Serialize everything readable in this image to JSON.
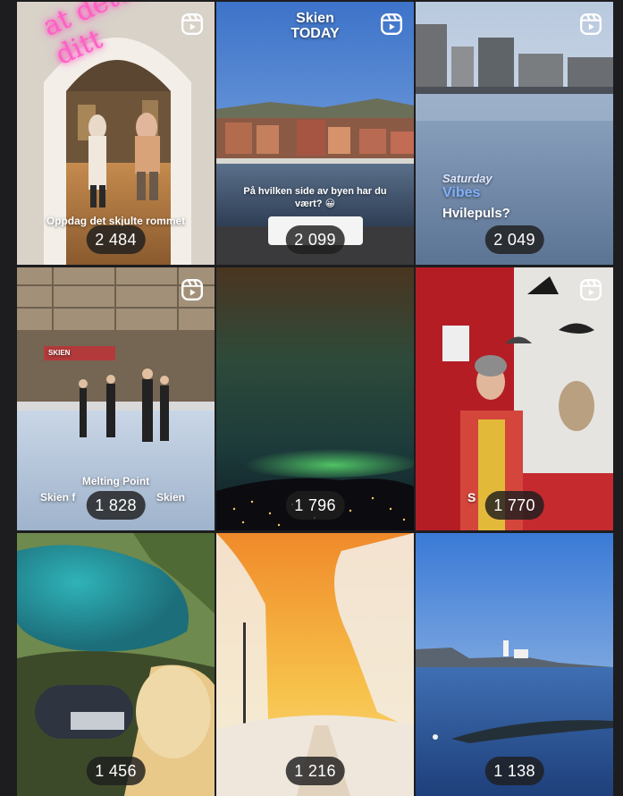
{
  "tiles": [
    {
      "count": "2 484",
      "is_reel": true,
      "neon_text": "at dette er ditt",
      "caption": "Oppdag det skjulte rommet"
    },
    {
      "count": "2 099",
      "is_reel": true,
      "title_top": "Skien",
      "title_bottom": "TODAY",
      "caption": "På hvilken side av byen har du vært? 😀"
    },
    {
      "count": "2 049",
      "is_reel": true,
      "script_text": "Saturday",
      "vibes_text": "Vibes",
      "caption": "Hvilepuls?"
    },
    {
      "count": "1 828",
      "is_reel": true,
      "sign_text": "SKIEN",
      "caption_top": "Melting Point",
      "caption_left": "Skien f",
      "caption_right": "Skien"
    },
    {
      "count": "1 796",
      "is_reel": false
    },
    {
      "count": "1 770",
      "is_reel": true,
      "caption": "S"
    },
    {
      "count": "1 456",
      "is_reel": false
    },
    {
      "count": "1 216",
      "is_reel": false
    },
    {
      "count": "1 138",
      "is_reel": false
    }
  ],
  "colors": {
    "background": "#1d1d1f",
    "badge": "#1e1e1e",
    "neon": "#ff5fc8"
  },
  "icons": {
    "reel": "reels-icon"
  }
}
